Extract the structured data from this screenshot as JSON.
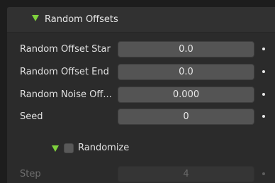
{
  "panel": {
    "title": "Random Offsets",
    "rows": [
      {
        "label": "Random Offset Star",
        "value": "0.0"
      },
      {
        "label": "Random Offset End",
        "value": "0.0"
      },
      {
        "label": "Random Noise Off...",
        "value": "0.000"
      },
      {
        "label": "Seed",
        "value": "0"
      }
    ],
    "randomize": {
      "label": "Randomize",
      "checked": false
    },
    "step": {
      "label": "Step",
      "value": "4"
    }
  },
  "colors": {
    "accent_green": "#7fd23d",
    "panel_bg": "#2b2b2b",
    "field_bg": "#545454"
  }
}
